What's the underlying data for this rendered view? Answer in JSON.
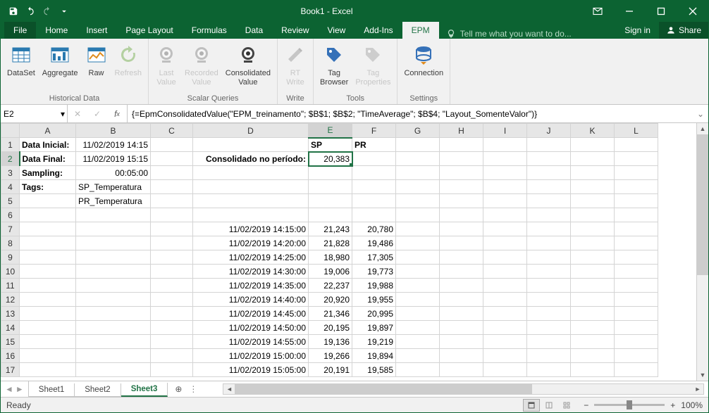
{
  "title": "Book1 - Excel",
  "menu_tabs": [
    "File",
    "Home",
    "Insert",
    "Page Layout",
    "Formulas",
    "Data",
    "Review",
    "View",
    "Add-Ins",
    "EPM"
  ],
  "active_tab": "EPM",
  "tellme_placeholder": "Tell me what you want to do...",
  "signin_label": "Sign in",
  "share_label": "Share",
  "ribbon": {
    "groups": [
      {
        "label": "Historical Data",
        "buttons": [
          {
            "label": "DataSet"
          },
          {
            "label": "Aggregate"
          },
          {
            "label": "Raw"
          },
          {
            "label": "Refresh",
            "disabled": true
          }
        ]
      },
      {
        "label": "Scalar Queries",
        "buttons": [
          {
            "label": "Last\nValue",
            "disabled": true
          },
          {
            "label": "Recorded\nValue",
            "disabled": true
          },
          {
            "label": "Consolidated\nValue"
          }
        ]
      },
      {
        "label": "Write",
        "buttons": [
          {
            "label": "RT\nWrite",
            "disabled": true
          }
        ]
      },
      {
        "label": "Tools",
        "buttons": [
          {
            "label": "Tag\nBrowser"
          },
          {
            "label": "Tag\nProperties",
            "disabled": true
          }
        ]
      },
      {
        "label": "Settings",
        "buttons": [
          {
            "label": "Connection"
          }
        ]
      }
    ]
  },
  "name_box": "E2",
  "formula": "{=EpmConsolidatedValue(\"EPM_treinamento\"; $B$1; $B$2; \"TimeAverage\"; $B$4; \"Layout_SomenteValor\")}",
  "columns": [
    "A",
    "B",
    "C",
    "D",
    "E",
    "F",
    "G",
    "H",
    "I",
    "J",
    "K",
    "L"
  ],
  "selected_cell": {
    "row": 2,
    "col": "E"
  },
  "cells": {
    "A1": {
      "v": "Data Inicial:",
      "b": true
    },
    "B1": {
      "v": "11/02/2019 14:15",
      "a": "r"
    },
    "E1": {
      "v": "SP",
      "b": true
    },
    "F1": {
      "v": "PR",
      "b": true
    },
    "A2": {
      "v": "Data Final:",
      "b": true
    },
    "B2": {
      "v": "11/02/2019 15:15",
      "a": "r"
    },
    "D2": {
      "v": "Consolidado no período:",
      "b": true,
      "a": "r"
    },
    "E2": {
      "v": "20,383",
      "a": "r"
    },
    "A3": {
      "v": "Sampling:",
      "b": true
    },
    "B3": {
      "v": "00:05:00",
      "a": "r"
    },
    "A4": {
      "v": "Tags:",
      "b": true
    },
    "B4": {
      "v": "SP_Temperatura"
    },
    "B5": {
      "v": "PR_Temperatura"
    },
    "D7": {
      "v": "11/02/2019 14:15:00",
      "a": "r"
    },
    "E7": {
      "v": "21,243",
      "a": "r"
    },
    "F7": {
      "v": "20,780",
      "a": "r"
    },
    "D8": {
      "v": "11/02/2019 14:20:00",
      "a": "r"
    },
    "E8": {
      "v": "21,828",
      "a": "r"
    },
    "F8": {
      "v": "19,486",
      "a": "r"
    },
    "D9": {
      "v": "11/02/2019 14:25:00",
      "a": "r"
    },
    "E9": {
      "v": "18,980",
      "a": "r"
    },
    "F9": {
      "v": "17,305",
      "a": "r"
    },
    "D10": {
      "v": "11/02/2019 14:30:00",
      "a": "r"
    },
    "E10": {
      "v": "19,006",
      "a": "r"
    },
    "F10": {
      "v": "19,773",
      "a": "r"
    },
    "D11": {
      "v": "11/02/2019 14:35:00",
      "a": "r"
    },
    "E11": {
      "v": "22,237",
      "a": "r"
    },
    "F11": {
      "v": "19,988",
      "a": "r"
    },
    "D12": {
      "v": "11/02/2019 14:40:00",
      "a": "r"
    },
    "E12": {
      "v": "20,920",
      "a": "r"
    },
    "F12": {
      "v": "19,955",
      "a": "r"
    },
    "D13": {
      "v": "11/02/2019 14:45:00",
      "a": "r"
    },
    "E13": {
      "v": "21,346",
      "a": "r"
    },
    "F13": {
      "v": "20,995",
      "a": "r"
    },
    "D14": {
      "v": "11/02/2019 14:50:00",
      "a": "r"
    },
    "E14": {
      "v": "20,195",
      "a": "r"
    },
    "F14": {
      "v": "19,897",
      "a": "r"
    },
    "D15": {
      "v": "11/02/2019 14:55:00",
      "a": "r"
    },
    "E15": {
      "v": "19,136",
      "a": "r"
    },
    "F15": {
      "v": "19,219",
      "a": "r"
    },
    "D16": {
      "v": "11/02/2019 15:00:00",
      "a": "r"
    },
    "E16": {
      "v": "19,266",
      "a": "r"
    },
    "F16": {
      "v": "19,894",
      "a": "r"
    },
    "D17": {
      "v": "11/02/2019 15:05:00",
      "a": "r"
    },
    "E17": {
      "v": "20,191",
      "a": "r"
    },
    "F17": {
      "v": "19,585",
      "a": "r"
    }
  },
  "row_count": 17,
  "sheet_tabs": [
    "Sheet1",
    "Sheet2",
    "Sheet3"
  ],
  "active_sheet": "Sheet3",
  "status_text": "Ready",
  "zoom": "100%"
}
